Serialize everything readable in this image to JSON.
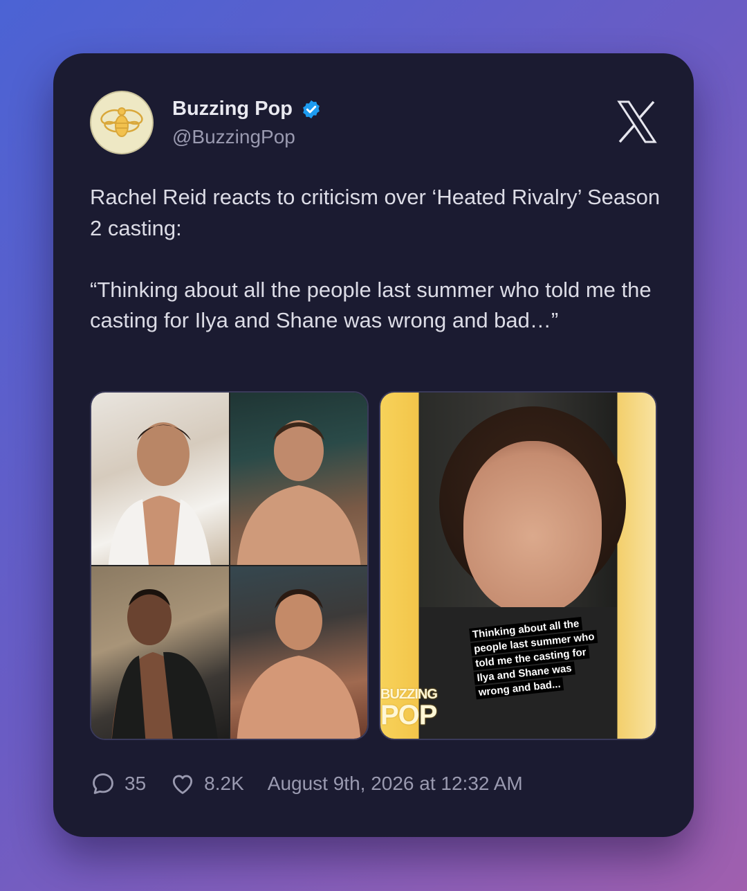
{
  "account": {
    "name": "Buzzing Pop",
    "handle": "@BuzzingPop",
    "verified": true
  },
  "tweet": {
    "text": "Rachel Reid reacts to criticism over ‘Heated Rivalry’ Season 2 casting:\n\n“Thinking about all the people last summer who told me the casting for Ilya and Shane was wrong and bad…”"
  },
  "media": {
    "story_caption": "Thinking about all the people last summer who told me the casting for Ilya and Shane was wrong and bad...",
    "brand_mark_top": "BUZZING",
    "brand_mark_bottom": "POP"
  },
  "footer": {
    "replies": "35",
    "likes": "8.2K",
    "timestamp": "August 9th, 2026 at 12:32 AM"
  },
  "colors": {
    "card_bg": "#1b1b31",
    "verified_blue": "#1d9bf0",
    "text_primary": "#e9e9f0",
    "text_secondary": "#9a9ab0"
  },
  "icons": [
    "bee-avatar-icon",
    "verified-badge-icon",
    "x-logo-icon",
    "reply-icon",
    "heart-icon"
  ]
}
